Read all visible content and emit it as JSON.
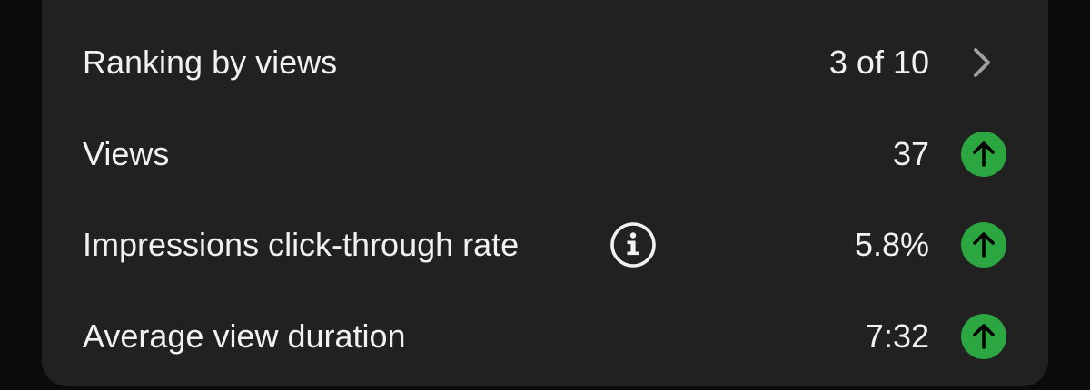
{
  "stats": {
    "ranking": {
      "label": "Ranking by views",
      "value": "3 of 10",
      "icon": "chevron-right-icon"
    },
    "views": {
      "label": "Views",
      "value": "37",
      "trend_icon": "arrow-up-icon"
    },
    "ctr": {
      "label": "Impressions click-through rate",
      "value": "5.8%",
      "info_icon": "info-icon",
      "trend_icon": "arrow-up-icon"
    },
    "avg_duration": {
      "label": "Average view duration",
      "value": "7:32",
      "trend_icon": "arrow-up-icon"
    }
  },
  "colors": {
    "card_bg": "#212121",
    "page_bg": "#0b0b0b",
    "text": "#f1f1f1",
    "trend_up": "#2ba640",
    "chevron": "#9e9e9e"
  }
}
